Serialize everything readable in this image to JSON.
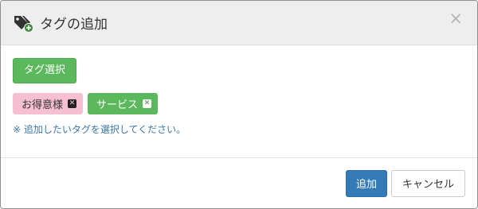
{
  "dialog": {
    "title": "タグの追加",
    "title_icon": "tags-add-icon",
    "close_label": "×"
  },
  "body": {
    "select_button_label": "タグ選択",
    "tags": [
      {
        "label": "お得意様",
        "color": "#f6c0d2"
      },
      {
        "label": "サービス",
        "color": "#5cb85c"
      }
    ],
    "note": "※ 追加したいタグを選択してください。"
  },
  "footer": {
    "add_label": "追加",
    "cancel_label": "キャンセル"
  },
  "colors": {
    "primary": "#337ab7",
    "success": "#5cb85c",
    "note_text": "#3a76a8"
  }
}
